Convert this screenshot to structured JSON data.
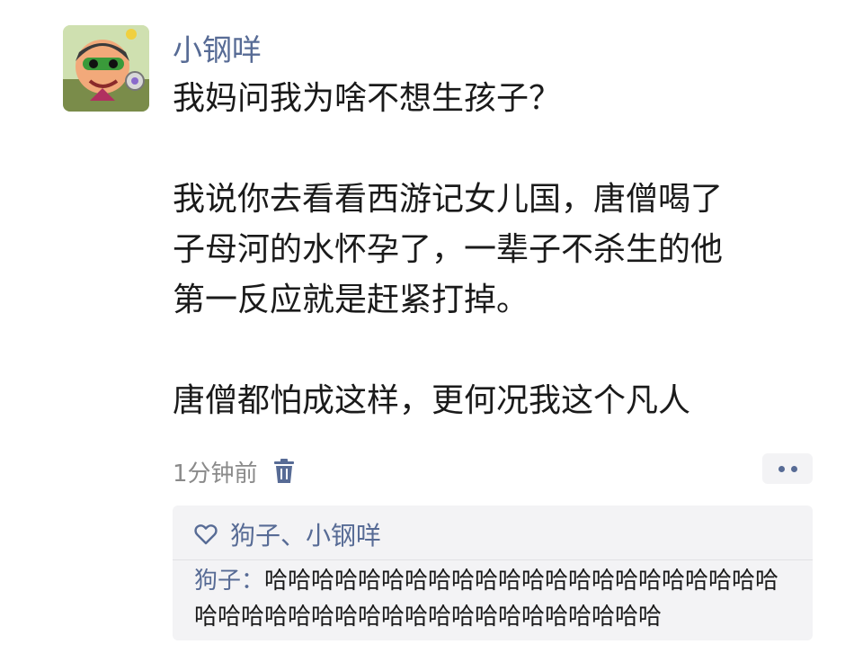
{
  "post": {
    "username": "小钢咩",
    "avatar_icon": "cartoon-character-avatar",
    "lines": {
      "l1": "我妈问我为啥不想生孩子？",
      "l2": "我说你去看看西游记女儿国，唐僧喝了",
      "l3": "子母河的水怀孕了，一辈子不杀生的他",
      "l4": "第一反应就是赶紧打掉。",
      "l5": "唐僧都怕成这样，更何况我这个凡人"
    },
    "timestamp": "1分钟前",
    "delete_icon": "trash-icon",
    "more_icon": "more-dots-icon"
  },
  "interactions": {
    "heart_icon": "heart-outline-icon",
    "likes": "狗子、小钢咩",
    "comment": {
      "author": "狗子",
      "separator": "：",
      "text": "哈哈哈哈哈哈哈哈哈哈哈哈哈哈哈哈哈哈哈哈哈哈哈哈哈哈哈哈哈哈哈哈哈哈哈哈哈哈哈哈哈哈"
    }
  },
  "colors": {
    "name_blue": "#576b95",
    "text": "#1a1a1a",
    "muted": "#8a8a8a",
    "panel": "#f3f3f5"
  }
}
